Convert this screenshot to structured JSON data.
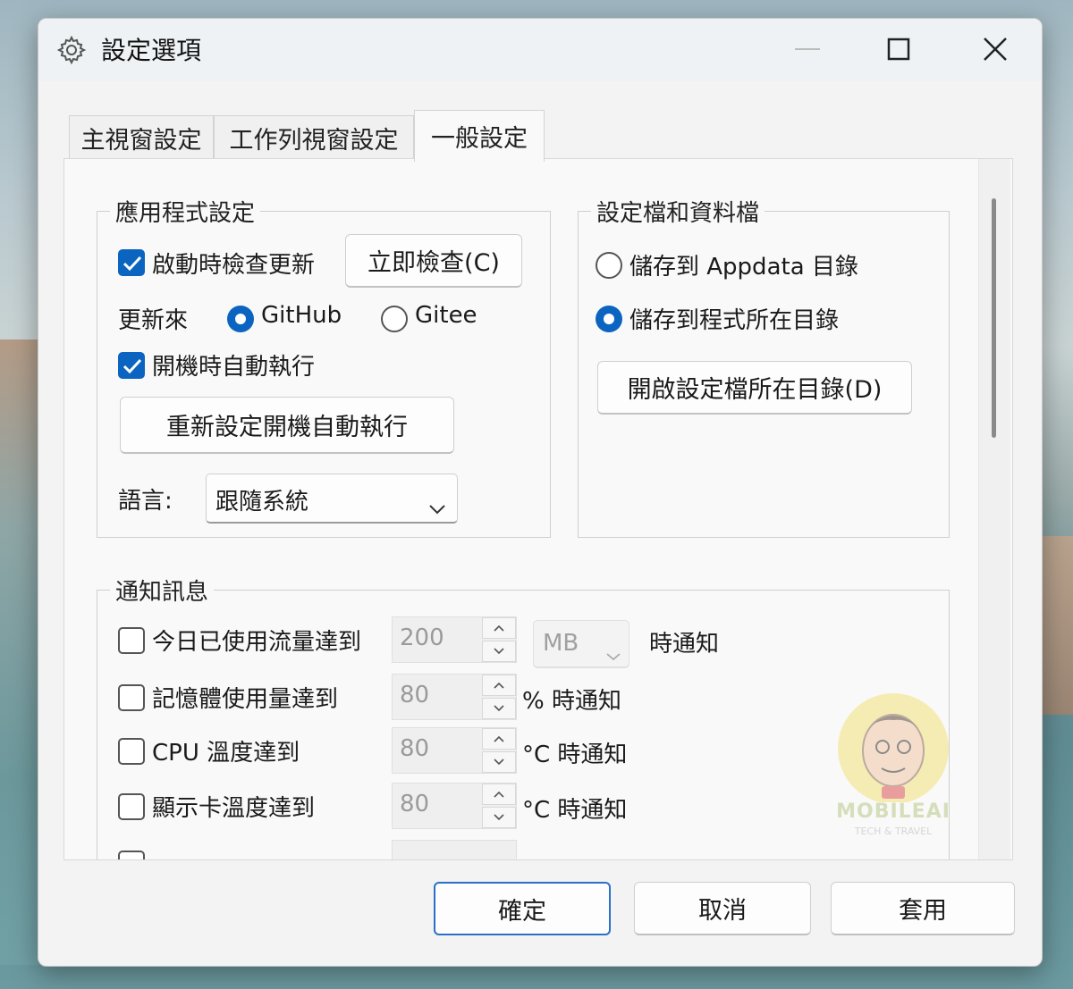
{
  "window": {
    "title": "設定選項"
  },
  "tabs": [
    {
      "label": "主視窗設定"
    },
    {
      "label": "工作列視窗設定"
    },
    {
      "label": "一般設定"
    }
  ],
  "app_settings": {
    "title": "應用程式設定",
    "check_update_on_start": {
      "label": "啟動時檢查更新",
      "checked": true
    },
    "check_now_button": "立即檢查(C)",
    "update_source_label": "更新來",
    "update_sources": [
      {
        "label": "GitHub",
        "selected": true
      },
      {
        "label": "Gitee",
        "selected": false
      }
    ],
    "auto_run": {
      "label": "開機時自動執行",
      "checked": true
    },
    "reset_auto_run_button": "重新設定開機自動執行",
    "language_label": "語言:",
    "language_value": "跟隨系統"
  },
  "config_files": {
    "title": "設定檔和資料檔",
    "options": [
      {
        "label": "儲存到 Appdata 目錄",
        "selected": false
      },
      {
        "label": "儲存到程式所在目錄",
        "selected": true
      }
    ],
    "open_dir_button": "開啟設定檔所在目錄(D)"
  },
  "notifications": {
    "title": "通知訊息",
    "items": [
      {
        "label": "今日已使用流量達到",
        "value": "200",
        "unit": "MB",
        "suffix": "時通知",
        "checked": false
      },
      {
        "label": "記憶體使用量達到",
        "value": "80",
        "suffix": "% 時通知",
        "checked": false
      },
      {
        "label": "CPU 溫度達到",
        "value": "80",
        "suffix": "°C 時通知",
        "checked": false
      },
      {
        "label": "顯示卡溫度達到",
        "value": "80",
        "suffix": "°C 時通知",
        "checked": false
      }
    ]
  },
  "watermark": {
    "text": "MOBILEAI",
    "subtext": "TECH & TRAVEL"
  },
  "footer": {
    "ok": "確定",
    "cancel": "取消",
    "apply": "套用"
  },
  "colors": {
    "accent": "#0b64c0",
    "primary_border": "#2a70c8"
  }
}
